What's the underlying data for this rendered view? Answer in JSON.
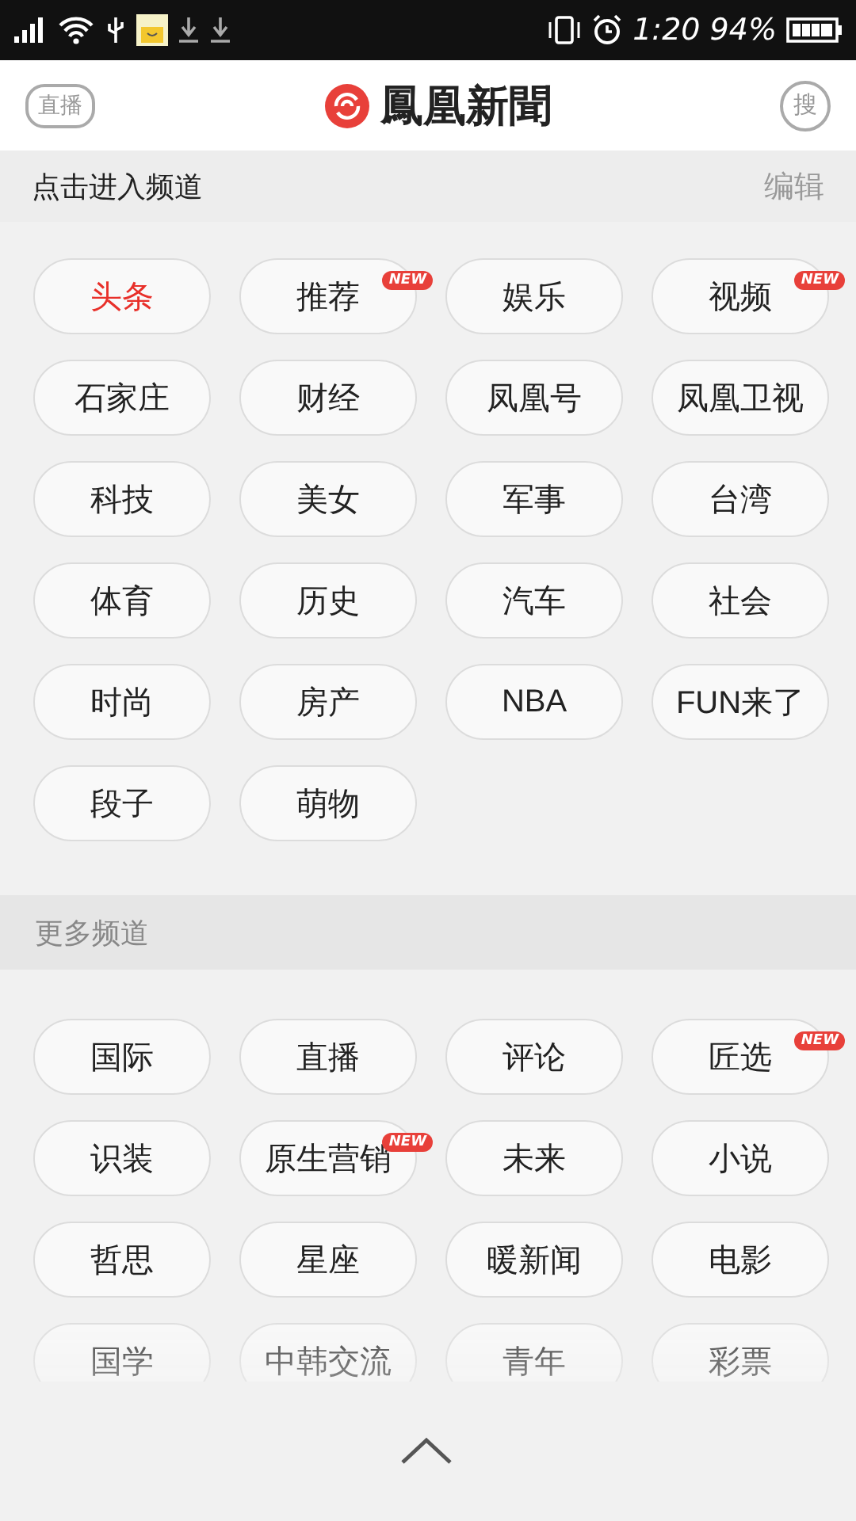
{
  "status_bar": {
    "time": "1:20",
    "battery": "94%"
  },
  "header": {
    "live_button": "直播",
    "title": "鳳凰新聞",
    "search_button": "搜"
  },
  "my_channels": {
    "title": "点击进入频道",
    "edit": "编辑",
    "items": [
      {
        "label": "头条",
        "selected": true
      },
      {
        "label": "推荐",
        "selected": false,
        "badge": "NEW"
      },
      {
        "label": "娱乐",
        "selected": false
      },
      {
        "label": "视频",
        "selected": false,
        "badge": "NEW"
      },
      {
        "label": "石家庄",
        "selected": false
      },
      {
        "label": "财经",
        "selected": false
      },
      {
        "label": "凤凰号",
        "selected": false
      },
      {
        "label": "凤凰卫视",
        "selected": false
      },
      {
        "label": "科技",
        "selected": false
      },
      {
        "label": "美女",
        "selected": false
      },
      {
        "label": "军事",
        "selected": false
      },
      {
        "label": "台湾",
        "selected": false
      },
      {
        "label": "体育",
        "selected": false
      },
      {
        "label": "历史",
        "selected": false
      },
      {
        "label": "汽车",
        "selected": false
      },
      {
        "label": "社会",
        "selected": false
      },
      {
        "label": "时尚",
        "selected": false
      },
      {
        "label": "房产",
        "selected": false
      },
      {
        "label": "NBA",
        "selected": false
      },
      {
        "label": "FUN来了",
        "selected": false
      },
      {
        "label": "段子",
        "selected": false
      },
      {
        "label": "萌物",
        "selected": false
      }
    ]
  },
  "more_channels": {
    "title": "更多频道",
    "items": [
      {
        "label": "国际"
      },
      {
        "label": "直播"
      },
      {
        "label": "评论"
      },
      {
        "label": "匠选",
        "badge": "NEW"
      },
      {
        "label": "识装"
      },
      {
        "label": "原生营销",
        "badge": "NEW"
      },
      {
        "label": "未来"
      },
      {
        "label": "小说"
      },
      {
        "label": "哲思"
      },
      {
        "label": "星座"
      },
      {
        "label": "暖新闻"
      },
      {
        "label": "电影"
      },
      {
        "label": "国学"
      },
      {
        "label": "中韩交流"
      },
      {
        "label": "青年"
      },
      {
        "label": "彩票"
      }
    ]
  }
}
